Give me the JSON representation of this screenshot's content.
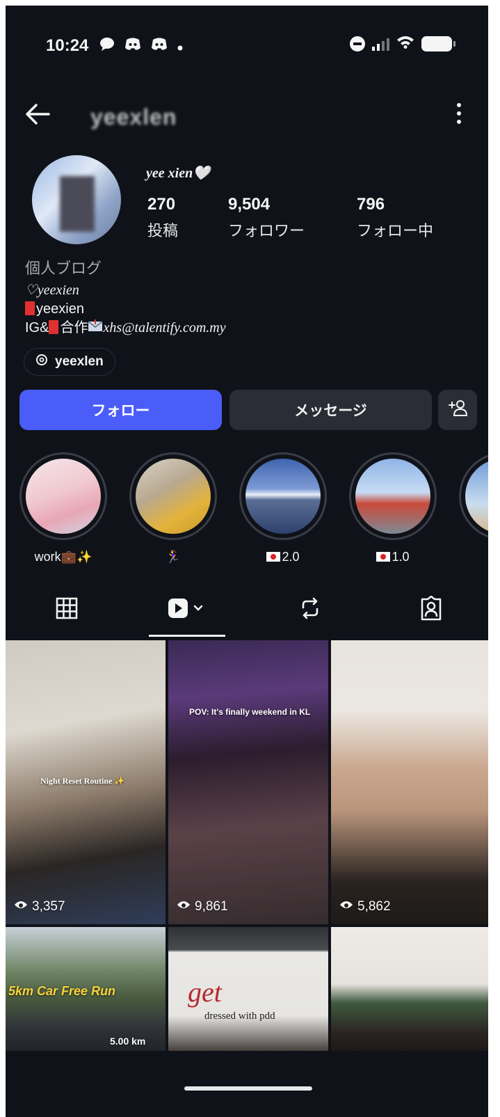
{
  "status_bar": {
    "time": "10:24",
    "left_icons": [
      "chat-icon",
      "discord-icon",
      "discord-icon",
      "dot-icon"
    ],
    "right_icons": [
      "do-not-disturb-icon",
      "signal-icon",
      "wifi-icon",
      "battery-icon"
    ]
  },
  "header": {
    "username": "yeexlen",
    "back_icon": "arrow-left-icon",
    "more_icon": "more-vertical-icon"
  },
  "profile": {
    "display_name": "yee xien🤍",
    "stats": [
      {
        "value": "270",
        "label": "投稿"
      },
      {
        "value": "9,504",
        "label": "フォロワー"
      },
      {
        "value": "796",
        "label": "フォロー中"
      }
    ],
    "category": "個人ブログ",
    "bio_line1": "♡yeexien",
    "bio_line2": "yeexien",
    "bio_line3_prefix": "IG&",
    "bio_line3_mid": "合作",
    "bio_line3_email": "xhs@talentify.com.my",
    "threads_handle": "yeexlen"
  },
  "actions": {
    "follow_label": "フォロー",
    "message_label": "メッセージ",
    "add_user_icon": "add-user-icon"
  },
  "highlights": [
    {
      "label": "work💼✨"
    },
    {
      "label": "🏃‍♀️"
    },
    {
      "label": "2.0"
    },
    {
      "label": "1.0"
    },
    {
      "label": ""
    }
  ],
  "tabs": [
    {
      "icon": "grid-icon"
    },
    {
      "icon": "reels-icon",
      "active": true
    },
    {
      "icon": "repost-icon"
    },
    {
      "icon": "tagged-icon"
    }
  ],
  "posts": [
    {
      "views": "3,357",
      "caption": "Night Reset Routine ✨"
    },
    {
      "views": "9,861",
      "caption": "POV: It's finally weekend in KL"
    },
    {
      "views": "5,862",
      "caption": ""
    },
    {
      "views": "",
      "caption": "5km Car Free Run",
      "sub": "5.00 km"
    },
    {
      "views": "",
      "caption": "get",
      "sub": "dressed with pdd"
    },
    {
      "views": "",
      "caption": ""
    }
  ],
  "colors": {
    "background": "#0f1219",
    "follow_button": "#4a5df9",
    "secondary_button": "#2a2d35"
  }
}
